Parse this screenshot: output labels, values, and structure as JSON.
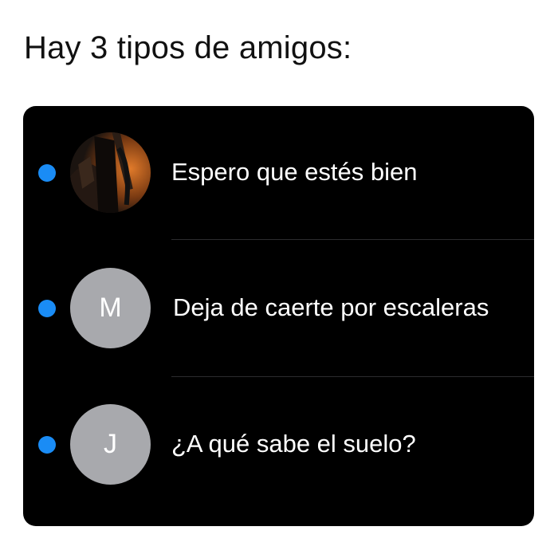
{
  "caption": "Hay 3 tipos de amigos:",
  "accent_color": "#1a8cf5",
  "panel_background": "#000000",
  "conversations": [
    {
      "avatar": "photo",
      "avatar_icon": "user-photo-icon",
      "unread": true,
      "message": "Espero que estés bien"
    },
    {
      "avatar": "M",
      "unread": true,
      "message": "Deja de caerte por escaleras"
    },
    {
      "avatar": "J",
      "unread": true,
      "message": "¿A qué sabe el suelo?"
    }
  ]
}
